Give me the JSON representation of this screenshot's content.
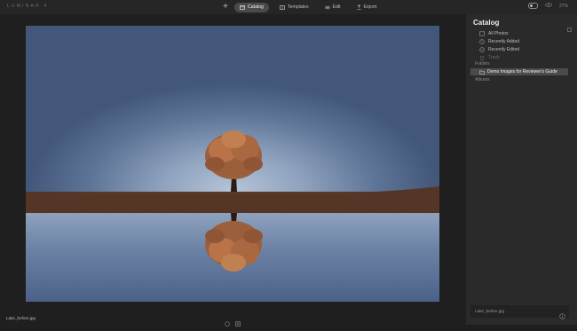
{
  "app": {
    "logo": "LUMINAR 4"
  },
  "topbar": {
    "add_label": "+",
    "tabs": [
      {
        "label": "Catalog",
        "icon": "catalog-icon",
        "active": true
      },
      {
        "label": "Templates",
        "icon": "templates-icon",
        "active": false
      },
      {
        "label": "Edit",
        "icon": "edit-icon",
        "active": false
      },
      {
        "label": "Export",
        "icon": "export-icon",
        "active": false
      }
    ],
    "zoom": "27%"
  },
  "sidebar": {
    "title": "Catalog",
    "items": [
      {
        "label": "All Photos",
        "icon": "photos-icon"
      },
      {
        "label": "Recently Added",
        "icon": "clock-icon"
      },
      {
        "label": "Recently Edited",
        "icon": "history-icon"
      },
      {
        "label": "Trash",
        "icon": "trash-icon"
      }
    ],
    "folders_label": "Folders",
    "folder": {
      "label": "Demo Images for Reviewer's Guide",
      "icon": "folder-icon"
    },
    "albums_label": "Albums",
    "info_filename": "Lake_before.jpg"
  },
  "status": {
    "filename": "Lake_before.jpg"
  },
  "colors": {
    "accent": "#4a4a4a",
    "panel": "#2a2a2a",
    "background": "#1f1f1f"
  }
}
